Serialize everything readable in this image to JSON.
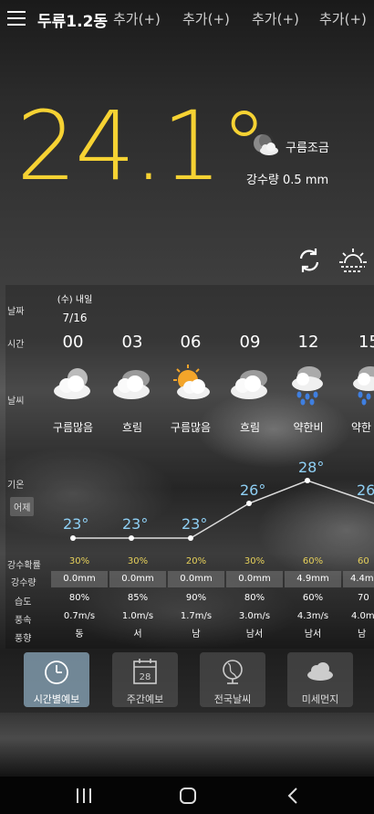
{
  "header": {
    "location": "두류1.2동",
    "tabs": [
      "추가(+)",
      "추가(+)",
      "추가(+)",
      "추가(+)"
    ]
  },
  "current": {
    "temperature": "24.1°",
    "condition": "구름조금",
    "precipitation": "강수량 0.5 mm"
  },
  "labels": {
    "date": "날짜",
    "time": "시간",
    "weather": "날씨",
    "temp": "기온",
    "yesterday": "어제",
    "prob": "강수확률",
    "amount": "강수량",
    "humidity": "습도",
    "wind_speed": "풍속",
    "wind_dir": "풍향"
  },
  "date_header": {
    "day": "(수) 내일",
    "date": "7/16"
  },
  "forecast": [
    {
      "hour": "00",
      "icon": "cloudy-icon",
      "weather": "구름많음",
      "temp": "23°",
      "prob": "30%",
      "amount": "0.0mm",
      "humidity": "80%",
      "wind_speed": "0.7m/s",
      "wind_dir": "동"
    },
    {
      "hour": "03",
      "icon": "overcast-icon",
      "weather": "흐림",
      "temp": "23°",
      "prob": "30%",
      "amount": "0.0mm",
      "humidity": "85%",
      "wind_speed": "1.0m/s",
      "wind_dir": "서"
    },
    {
      "hour": "06",
      "icon": "sun-cloud-icon",
      "weather": "구름많음",
      "temp": "23°",
      "prob": "20%",
      "amount": "0.0mm",
      "humidity": "90%",
      "wind_speed": "1.7m/s",
      "wind_dir": "남"
    },
    {
      "hour": "09",
      "icon": "overcast-icon",
      "weather": "흐림",
      "temp": "26°",
      "prob": "30%",
      "amount": "0.0mm",
      "humidity": "80%",
      "wind_speed": "3.0m/s",
      "wind_dir": "남서"
    },
    {
      "hour": "12",
      "icon": "rain-cloud-icon",
      "weather": "약한비",
      "temp": "28°",
      "prob": "60%",
      "amount": "4.9mm",
      "humidity": "60%",
      "wind_speed": "4.3m/s",
      "wind_dir": "남서"
    },
    {
      "hour": "15",
      "icon": "rain-cloud-icon",
      "weather": "약한",
      "temp": "26",
      "prob": "60",
      "amount": "4.4m",
      "humidity": "70",
      "wind_speed": "4.0m",
      "wind_dir": "남서"
    }
  ],
  "bottom_nav": [
    {
      "label": "시간별예보",
      "icon": "clock-icon",
      "active": true
    },
    {
      "label": "주간예보",
      "icon": "calendar-icon",
      "calendar_day": "28",
      "active": false
    },
    {
      "label": "전국날씨",
      "icon": "globe-icon",
      "active": false
    },
    {
      "label": "미세먼지",
      "icon": "cloud-icon",
      "active": false
    }
  ],
  "colors": {
    "temperature": "#f6d233",
    "probability": "#e6d05a",
    "temp_label": "#8fd0f5"
  }
}
